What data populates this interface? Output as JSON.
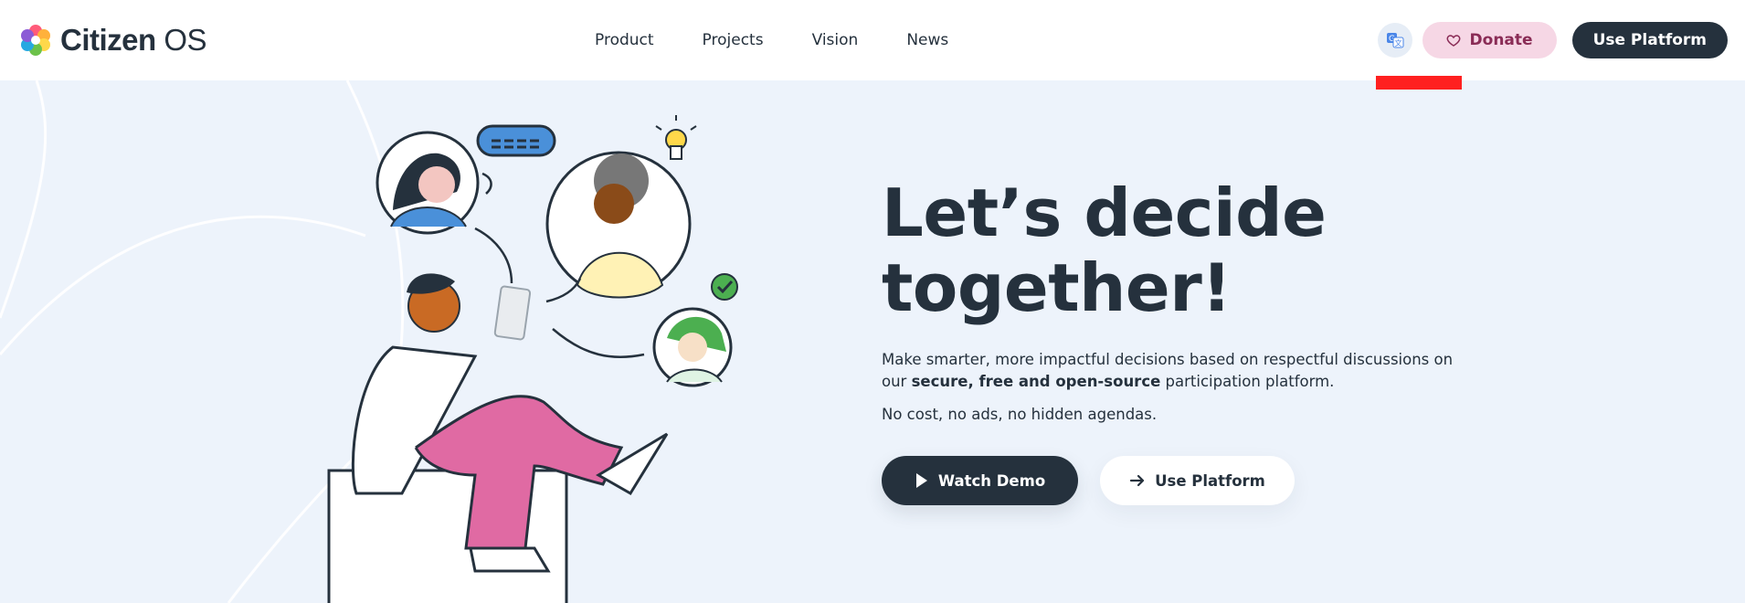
{
  "brand": {
    "name_bold": "Citizen",
    "name_light": " OS"
  },
  "nav": [
    {
      "label": "Product"
    },
    {
      "label": "Projects"
    },
    {
      "label": "Vision"
    },
    {
      "label": "News"
    }
  ],
  "header_actions": {
    "translate_icon": "translate-icon",
    "donate_label": "Donate",
    "use_platform_label": "Use Platform"
  },
  "hero": {
    "title_line1": "Let’s decide",
    "title_line2": "together!",
    "desc_before": "Make smarter, more impactful decisions based on respectful discussions on our ",
    "desc_bold": "secure, free and open-source",
    "desc_after": " participation platform.",
    "note": "No cost, no ads, no hidden agendas.",
    "watch_demo_label": "Watch Demo",
    "use_platform_label": "Use Platform"
  },
  "colors": {
    "accent_dark": "#25313d",
    "donate_bg": "#f6d7e5",
    "pink": "#e06aa3",
    "hero_bg": "#edf3fb"
  }
}
